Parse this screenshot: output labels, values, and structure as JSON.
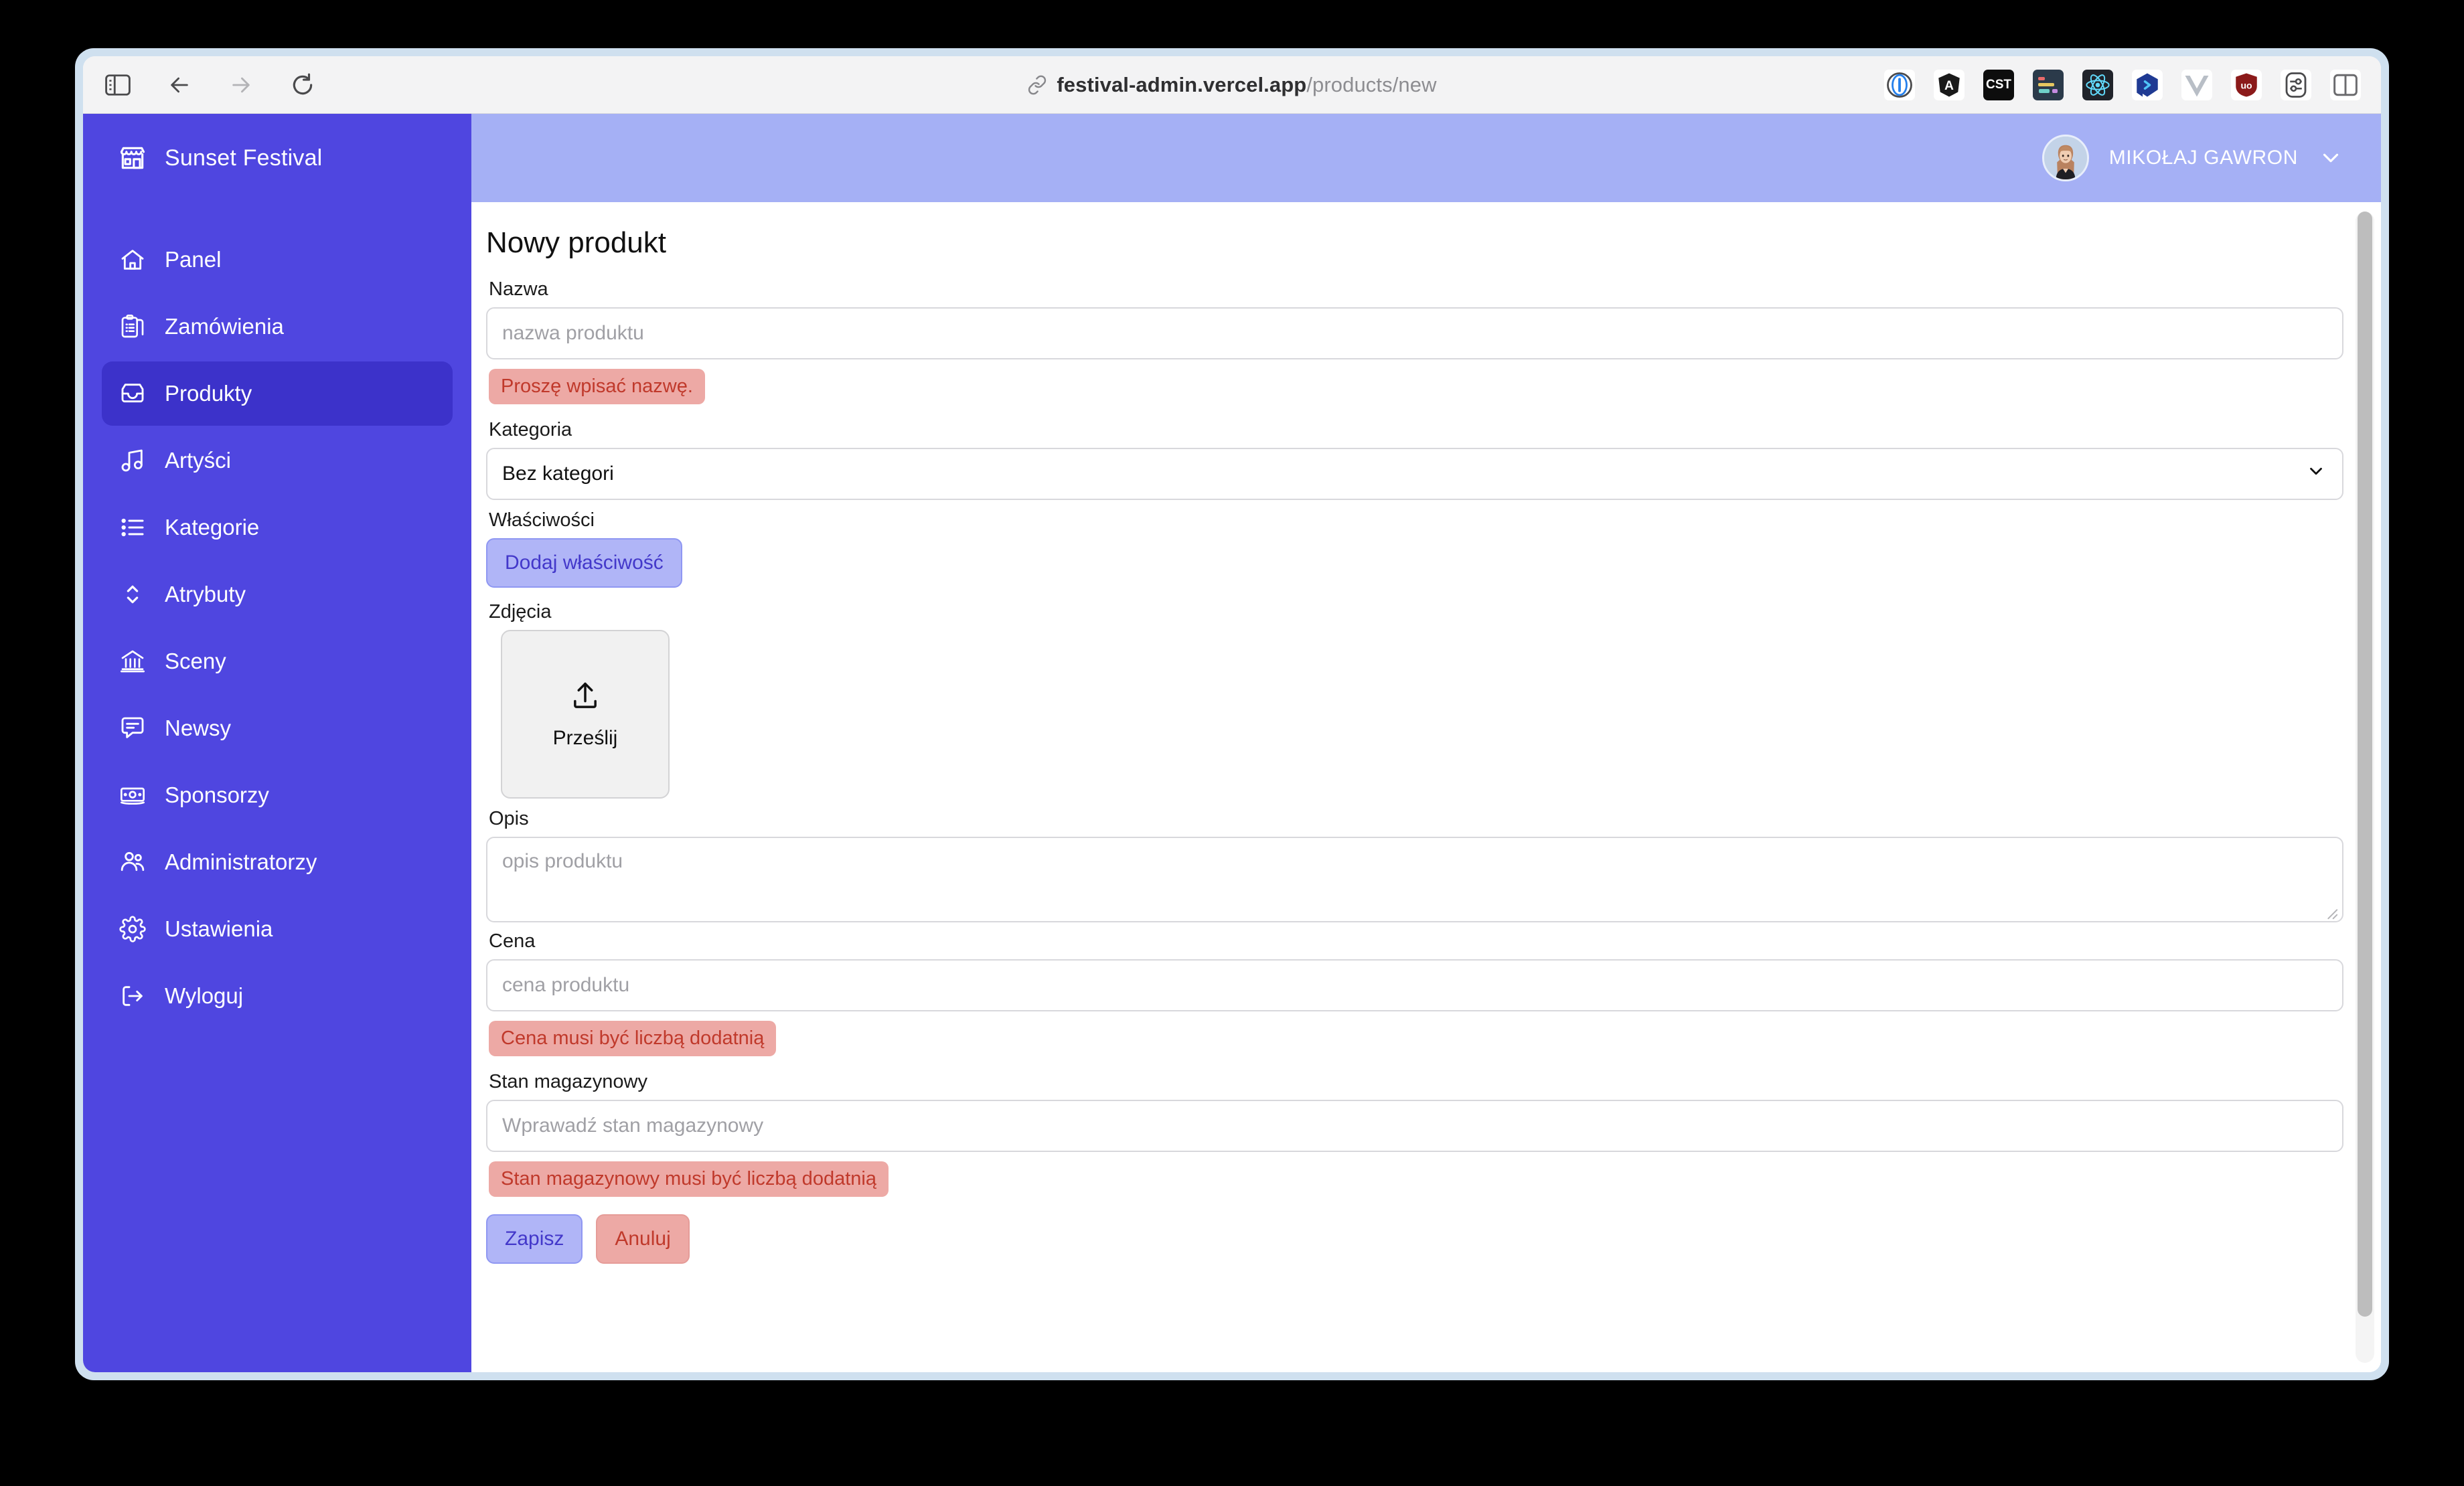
{
  "browser": {
    "url_host": "festival-admin.vercel.app",
    "url_path": "/products/new",
    "sidebar_toggle": "sidebar-toggle",
    "back": "back",
    "forward": "forward",
    "reload": "reload",
    "extensions": [
      {
        "name": "1password-icon",
        "label": "1"
      },
      {
        "name": "angular-devtools-icon",
        "label": "A"
      },
      {
        "name": "cst-extension-icon",
        "label": "CST"
      },
      {
        "name": "autofill-extension-icon",
        "label": ""
      },
      {
        "name": "react-devtools-icon",
        "label": ""
      },
      {
        "name": "blue-chat-extension-icon",
        "label": ""
      },
      {
        "name": "vue-devtools-icon",
        "label": "V"
      },
      {
        "name": "ublock-origin-icon",
        "label": "uo"
      },
      {
        "name": "extension-settings-icon",
        "label": ""
      },
      {
        "name": "panel-layout-icon",
        "label": ""
      }
    ]
  },
  "sidebar": {
    "brand": "Sunset Festival",
    "items": [
      {
        "label": "Panel",
        "icon": "home-icon",
        "active": false
      },
      {
        "label": "Zamówienia",
        "icon": "clipboard-list-icon",
        "active": false
      },
      {
        "label": "Produkty",
        "icon": "inbox-icon",
        "active": true
      },
      {
        "label": "Artyści",
        "icon": "music-note-icon",
        "active": false
      },
      {
        "label": "Kategorie",
        "icon": "list-icon",
        "active": false
      },
      {
        "label": "Atrybuty",
        "icon": "chevron-updown-icon",
        "active": false
      },
      {
        "label": "Sceny",
        "icon": "bank-icon",
        "active": false
      },
      {
        "label": "Newsy",
        "icon": "comment-icon",
        "active": false
      },
      {
        "label": "Sponsorzy",
        "icon": "banknote-icon",
        "active": false
      },
      {
        "label": "Administratorzy",
        "icon": "users-icon",
        "active": false
      },
      {
        "label": "Ustawienia",
        "icon": "gear-icon",
        "active": false
      },
      {
        "label": "Wyloguj",
        "icon": "logout-icon",
        "active": false
      }
    ]
  },
  "topbar": {
    "user_name": "MIKOŁAJ GAWRON",
    "caret": "chevron-down-icon"
  },
  "form": {
    "title": "Nowy produkt",
    "name": {
      "label": "Nazwa",
      "placeholder": "nazwa produktu",
      "value": "",
      "error": "Proszę wpisać nazwę."
    },
    "category": {
      "label": "Kategoria",
      "value": "Bez kategori"
    },
    "properties": {
      "label": "Właściwości",
      "add_button": "Dodaj właściwość"
    },
    "photos": {
      "label": "Zdjęcia",
      "upload_label": "Prześlij",
      "upload_icon": "upload-icon"
    },
    "description": {
      "label": "Opis",
      "placeholder": "opis produktu",
      "value": ""
    },
    "price": {
      "label": "Cena",
      "placeholder": "cena produktu",
      "value": "",
      "error": "Cena musi być liczbą dodatnią"
    },
    "stock": {
      "label": "Stan magazynowy",
      "placeholder": "Wprawadź stan magazynowy",
      "value": "",
      "error": "Stan magazynowy musi być liczbą dodatnią"
    },
    "save_button": "Zapisz",
    "cancel_button": "Anuluj"
  },
  "colors": {
    "sidebar": "#4f46e0",
    "sidebar_active": "#3c32ca",
    "topbar": "#a5b0f5",
    "error_bg": "#eda9a5",
    "error_text": "#c0392b",
    "primary_btn_bg": "#b0b5f7"
  }
}
